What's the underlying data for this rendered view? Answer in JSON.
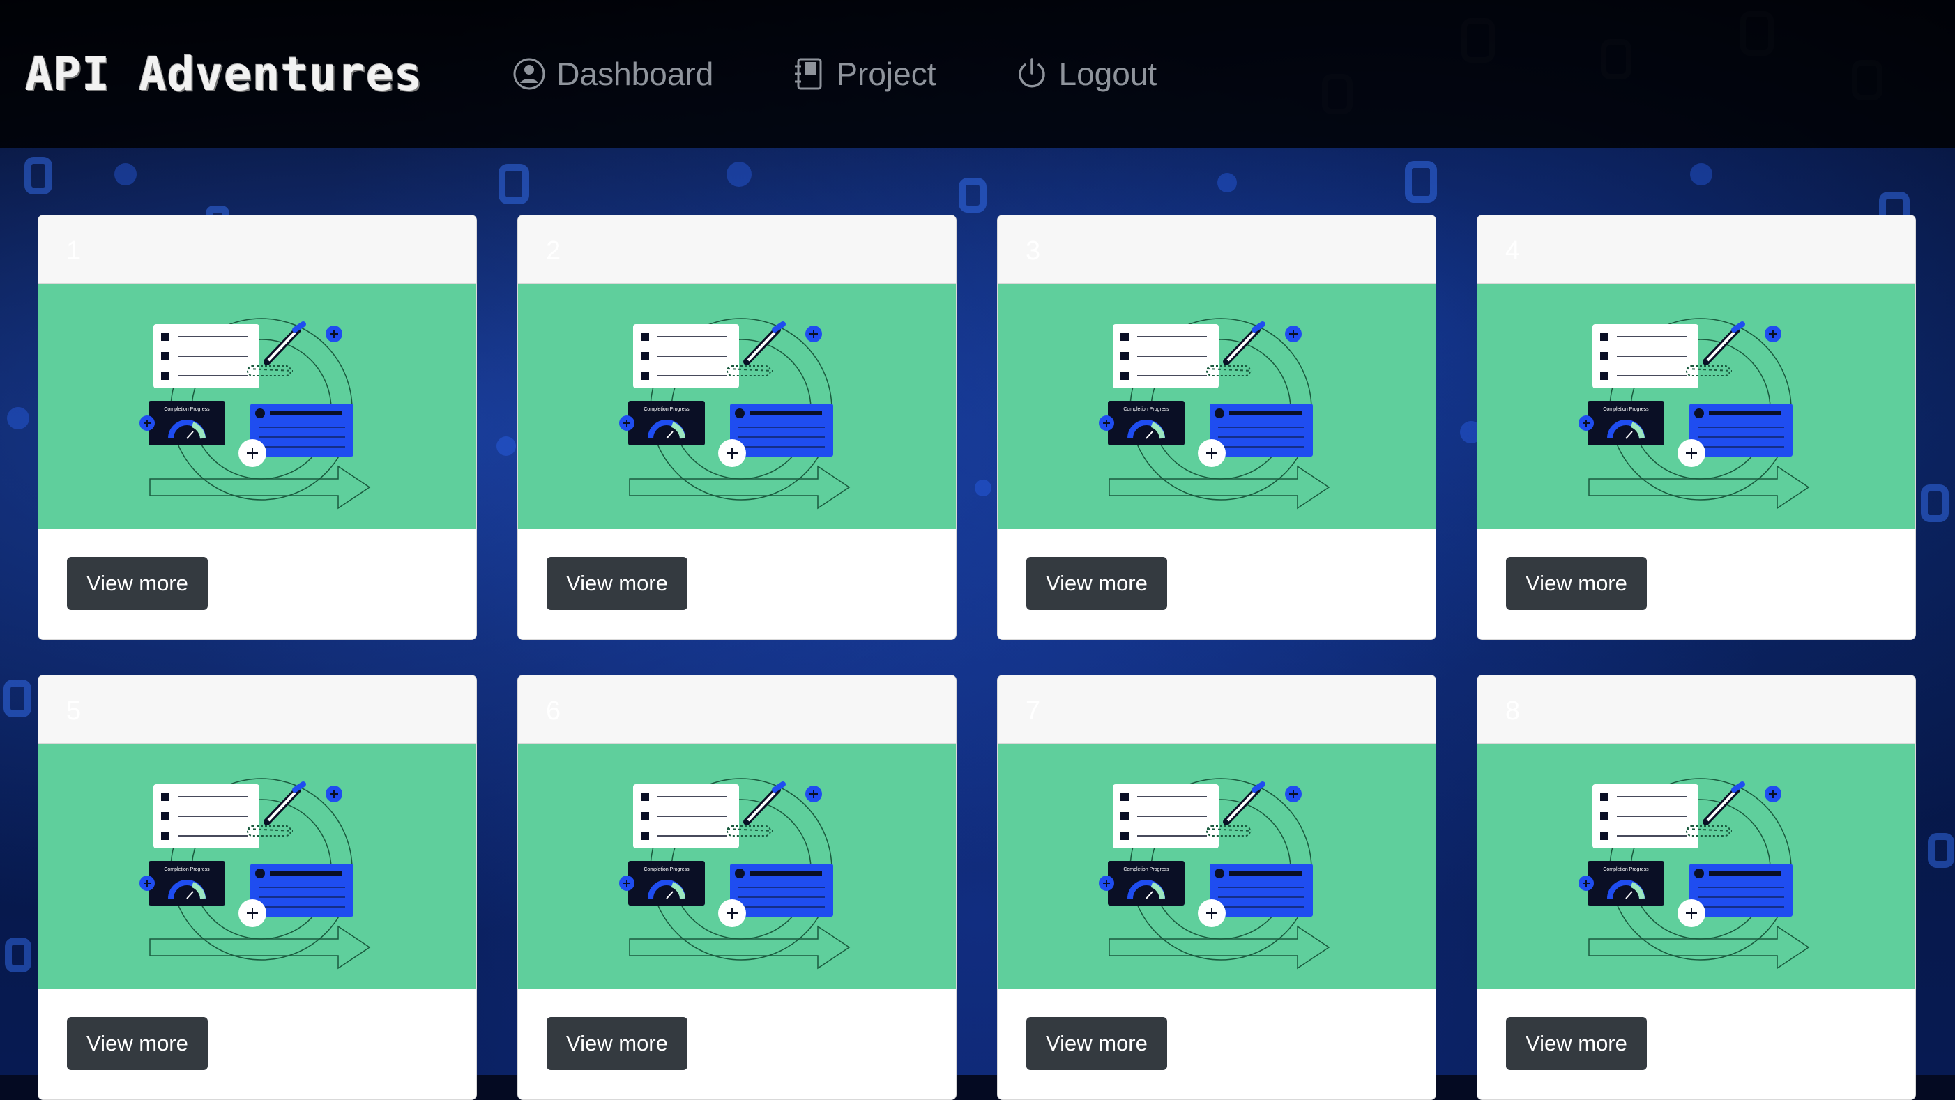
{
  "navbar": {
    "brand": "API Adventures",
    "items": [
      {
        "label": "Dashboard",
        "icon": "user-circle-icon"
      },
      {
        "label": "Project",
        "icon": "journal-icon"
      },
      {
        "label": "Logout",
        "icon": "power-icon"
      }
    ]
  },
  "cards": [
    {
      "number": "1",
      "button": "View more"
    },
    {
      "number": "2",
      "button": "View more"
    },
    {
      "number": "3",
      "button": "View more"
    },
    {
      "number": "4",
      "button": "View more"
    },
    {
      "number": "5",
      "button": "View more"
    },
    {
      "number": "6",
      "button": "View more"
    },
    {
      "number": "7",
      "button": "View more"
    },
    {
      "number": "8",
      "button": "View more"
    }
  ],
  "illustration": {
    "gauge_caption": "Completion Progress"
  },
  "colors": {
    "navbar_bg": "#000000",
    "card_image_bg": "#5fcf9c",
    "button_bg": "#343a40",
    "accent_blue": "#1f4df0"
  }
}
